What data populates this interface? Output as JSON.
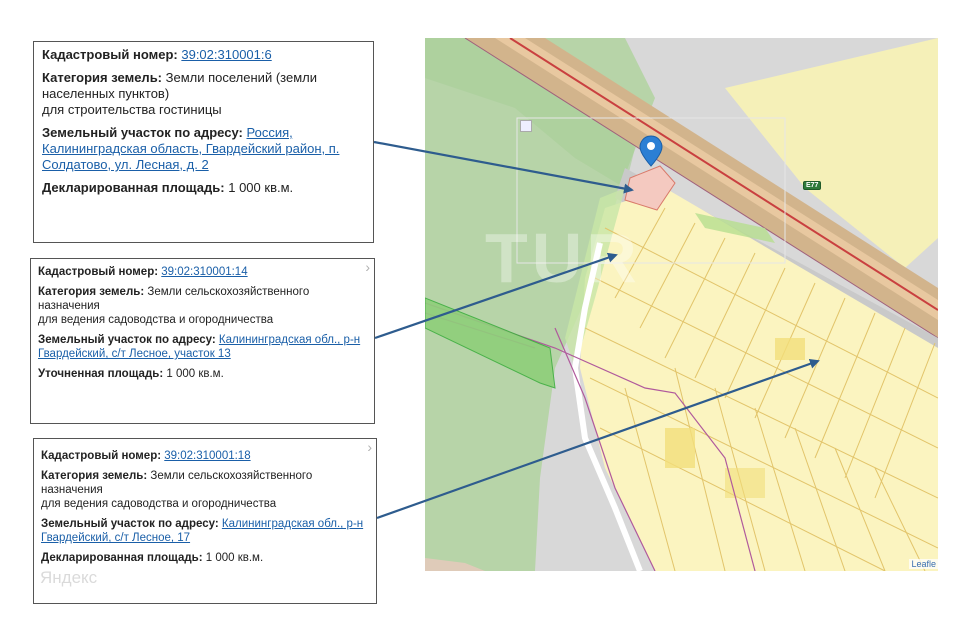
{
  "cards": [
    {
      "cadastral_label": "Кадастровый номер:",
      "cadastral_number": "39:02:310001:6",
      "category_label": "Категория земель:",
      "category_value": "Земли поселений (земли населенных пунктов)",
      "purpose": "для строительства гостиницы",
      "address_label": "Земельный участок по адресу:",
      "address_value": "Россия, Калининградская область, Гвардейский район, п. Солдатово, ул. Лесная, д. 2",
      "area_label": "Декларированная площадь:",
      "area_value": "1 000 кв.м."
    },
    {
      "close": "›",
      "cadastral_label": "Кадастровый номер:",
      "cadastral_number": "39:02:310001:14",
      "category_label": "Категория земель:",
      "category_value": "Земли сельскохозяйственного назначения",
      "purpose": "для ведения садоводства и огородничества",
      "address_label": "Земельный участок по адресу:",
      "address_value": "Калининградская обл., р-н Гвардейский, с/т Лесное, участок 13",
      "area_label": "Уточненная площадь:",
      "area_value": "1 000 кв.м."
    },
    {
      "close": "›",
      "cadastral_label": "Кадастровый номер:",
      "cadastral_number": "39:02:310001:18",
      "category_label": "Категория земель:",
      "category_value": "Земли сельскохозяйственного назначения",
      "purpose": "для ведения садоводства и огородничества",
      "address_label": "Земельный участок по адресу:",
      "address_value": "Калининградская обл., р-н Гвардейский, с/т Лесное, 17",
      "area_label": "Декларированная площадь:",
      "area_value": "1 000 кв.м."
    }
  ],
  "map": {
    "road_label": "E77",
    "attribution": "Leafle",
    "watermark": "TUR"
  },
  "watermark_bottom": "Яндекс"
}
